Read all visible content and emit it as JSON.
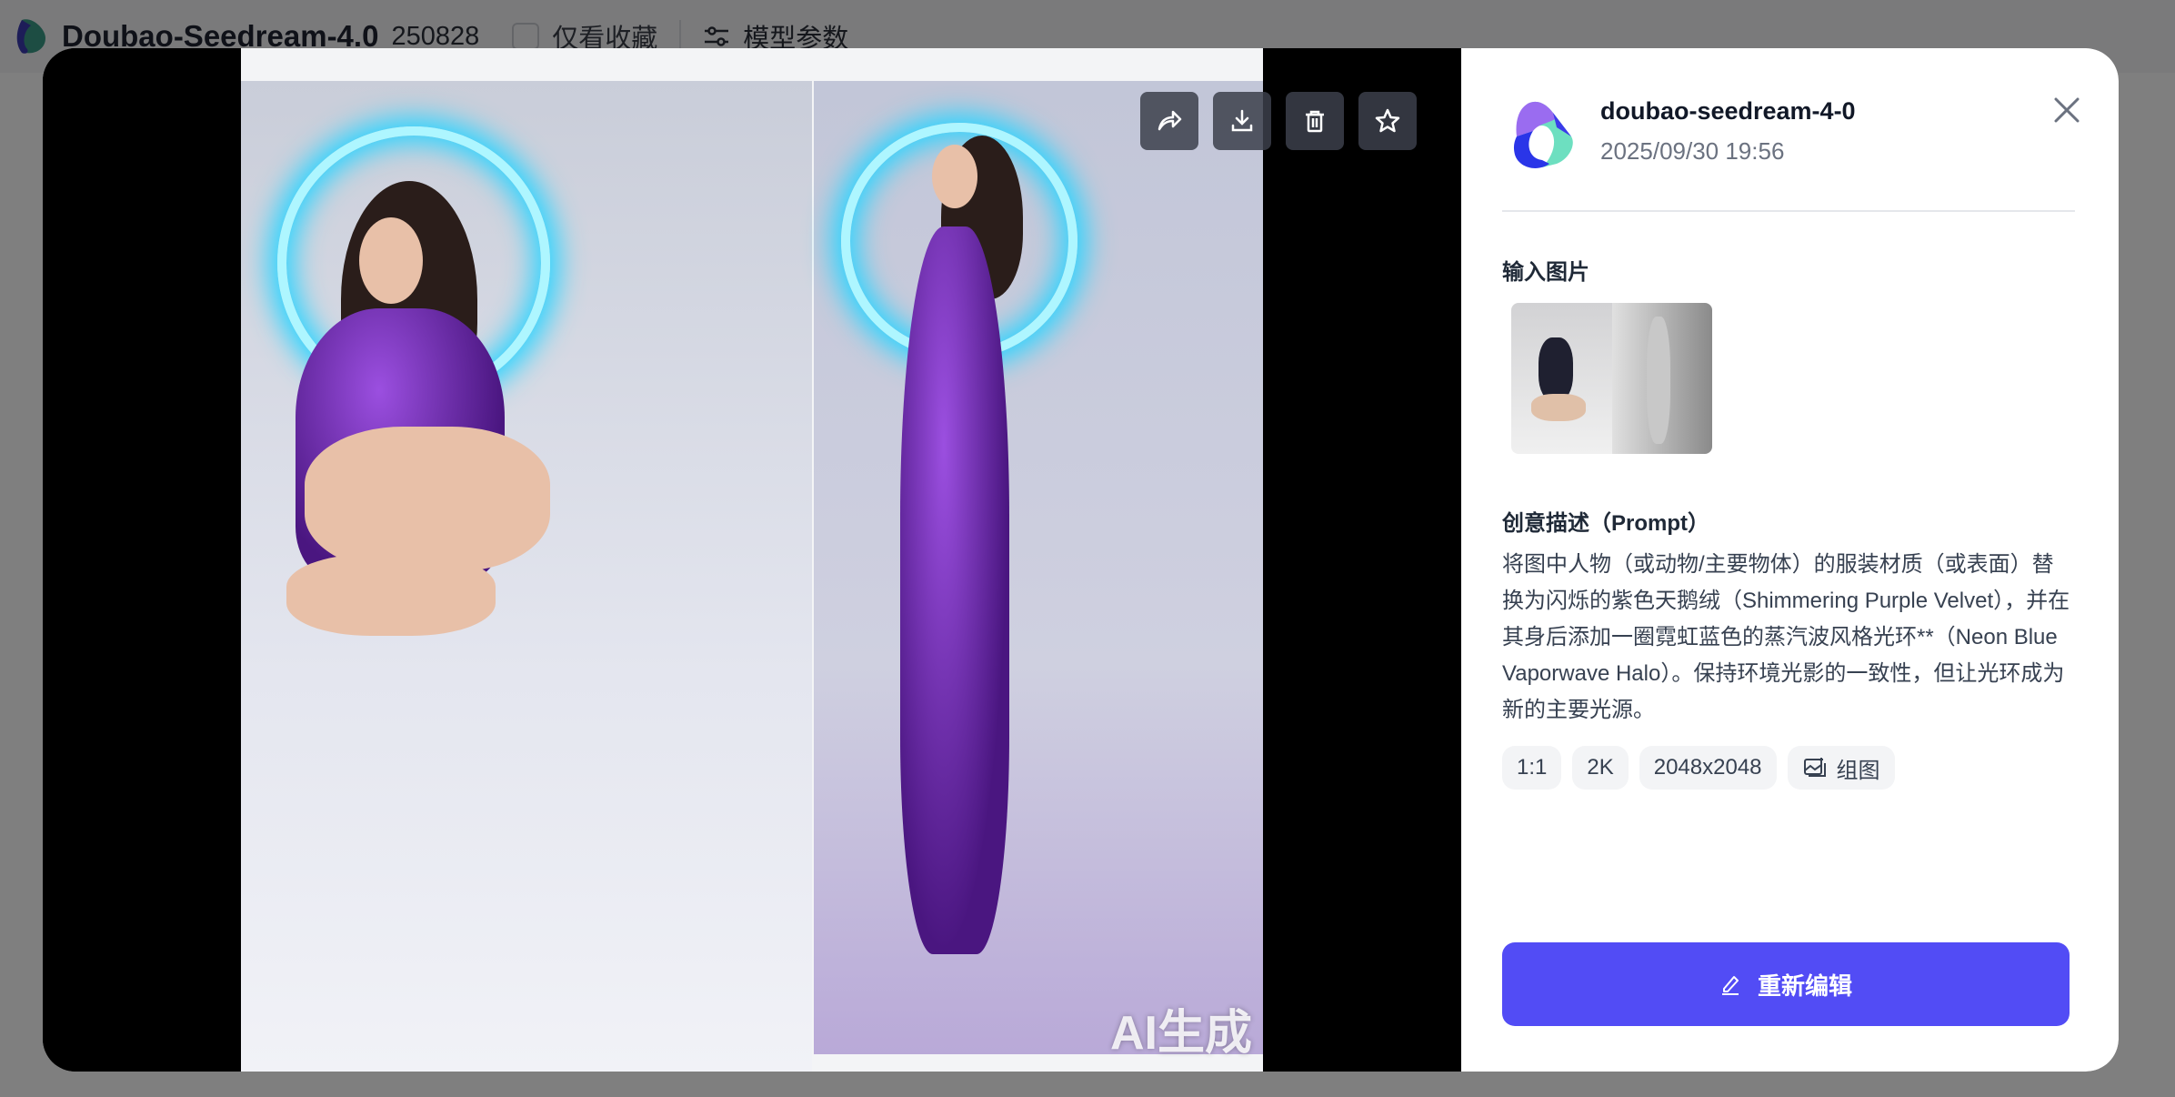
{
  "app": {
    "title": "Doubao-Seedream-4.0",
    "version": "250828",
    "favorites_only_label": "仅看收藏",
    "model_params_label": "模型参数"
  },
  "viewer": {
    "watermark": "AI生成",
    "tools": [
      "share-icon",
      "download-icon",
      "delete-icon",
      "star-icon"
    ]
  },
  "details": {
    "model_name": "doubao-seedream-4-0",
    "timestamp": "2025/09/30 19:56",
    "input_images_label": "输入图片",
    "prompt_label": "创意描述（Prompt）",
    "prompt": "将图中人物（或动物/主要物体）的服装材质（或表面）替换为闪烁的紫色天鹅绒（Shimmering Purple Velvet），并在其身后添加一圈霓虹蓝色的蒸汽波风格光环**（Neon Blue Vaporwave Halo）。保持环境光影的一致性，但让光环成为新的主要光源。",
    "chips": {
      "ratio": "1:1",
      "resolution": "2K",
      "size": "2048x2048",
      "mode": "组图"
    },
    "reedit_label": "重新编辑"
  },
  "colors": {
    "accent": "#524cf5",
    "halo": "#2bd4ff",
    "velvet": "#7a2fc8"
  }
}
